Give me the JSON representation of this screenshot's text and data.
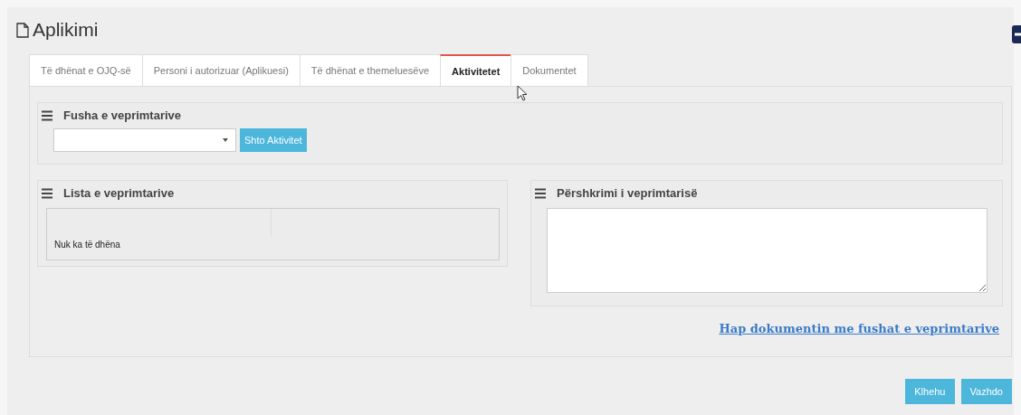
{
  "page": {
    "title": "Aplikimi"
  },
  "tabs": [
    {
      "label": "Të dhënat e OJQ-së",
      "selected": false
    },
    {
      "label": "Personi i autorizuar (Aplikuesi)",
      "selected": false
    },
    {
      "label": "Të dhënat e themeluesëve",
      "selected": false
    },
    {
      "label": "Aktivitetet",
      "selected": true
    },
    {
      "label": "Dokumentet",
      "selected": false
    }
  ],
  "fields_panel": {
    "title": "Fusha e veprimtarive",
    "add_button": "Shto Aktivitet"
  },
  "list_panel": {
    "title": "Lista e veprimtarive",
    "empty_message": "Nuk ka të dhëna"
  },
  "description_panel": {
    "title": "Përshkrimi i veprimtarisë"
  },
  "link": "Hap dokumentin me fushat e veprimtarive",
  "buttons": [
    "Klhehu",
    "Vazhdo"
  ]
}
